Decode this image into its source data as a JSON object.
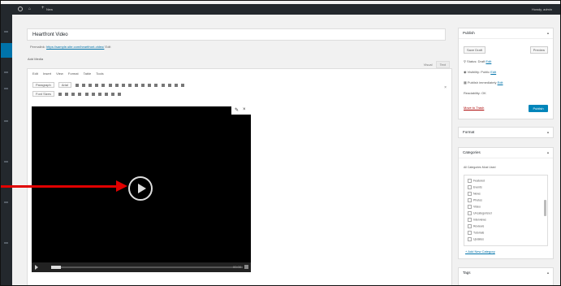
{
  "adminbar": {
    "home": "⌂",
    "new_plus": "+",
    "new_label": "New",
    "howdy": "Howdy, admin"
  },
  "post": {
    "title": "Heartfront Video",
    "permalink_label": "Permalink:",
    "permalink_url": "https://sample-site.com/heartfront-video/",
    "permalink_edit": "Edit"
  },
  "editor": {
    "add_media": "Add Media",
    "tab_visual": "Visual",
    "tab_text": "Text",
    "menus": [
      "Edit",
      "Insert",
      "View",
      "Format",
      "Table",
      "Tools"
    ],
    "format_select": "Paragraph",
    "font_select": "Arial",
    "size_select": "Font Sizes",
    "expand_icon": "×"
  },
  "video": {
    "edit_icon": "✎",
    "remove_icon": "×",
    "time": "00:00"
  },
  "sidebar": {
    "publish": {
      "title": "Publish",
      "toggle": "▲",
      "save_draft": "Save Draft",
      "preview": "Preview",
      "status_label": "Status:",
      "status_value": "Draft",
      "status_edit": "Edit",
      "visibility_label": "Visibility:",
      "visibility_value": "Public",
      "visibility_edit": "Edit",
      "schedule_label": "Publish immediately",
      "schedule_edit": "Edit",
      "readability": "Readability: OK",
      "trash": "Move to Trash",
      "publish_button": "Publish"
    },
    "format": {
      "title": "Format",
      "toggle": "▲"
    },
    "categories": {
      "title": "Categories",
      "toggle": "▲",
      "tabs": "All Categories   Most Used",
      "items": [
        "Featured",
        "Events",
        "News",
        "Photos",
        "Video",
        "Uncategorized",
        "Interviews",
        "Reviews",
        "Tutorials",
        "Updates"
      ],
      "add_new": "+ Add New Category"
    },
    "tags": {
      "title": "Tags",
      "toggle": "▲"
    }
  },
  "colors": {
    "admin_dark": "#23282d",
    "accent_blue": "#0073aa",
    "publish_blue": "#0085ba",
    "annotation_red": "#e10000"
  }
}
